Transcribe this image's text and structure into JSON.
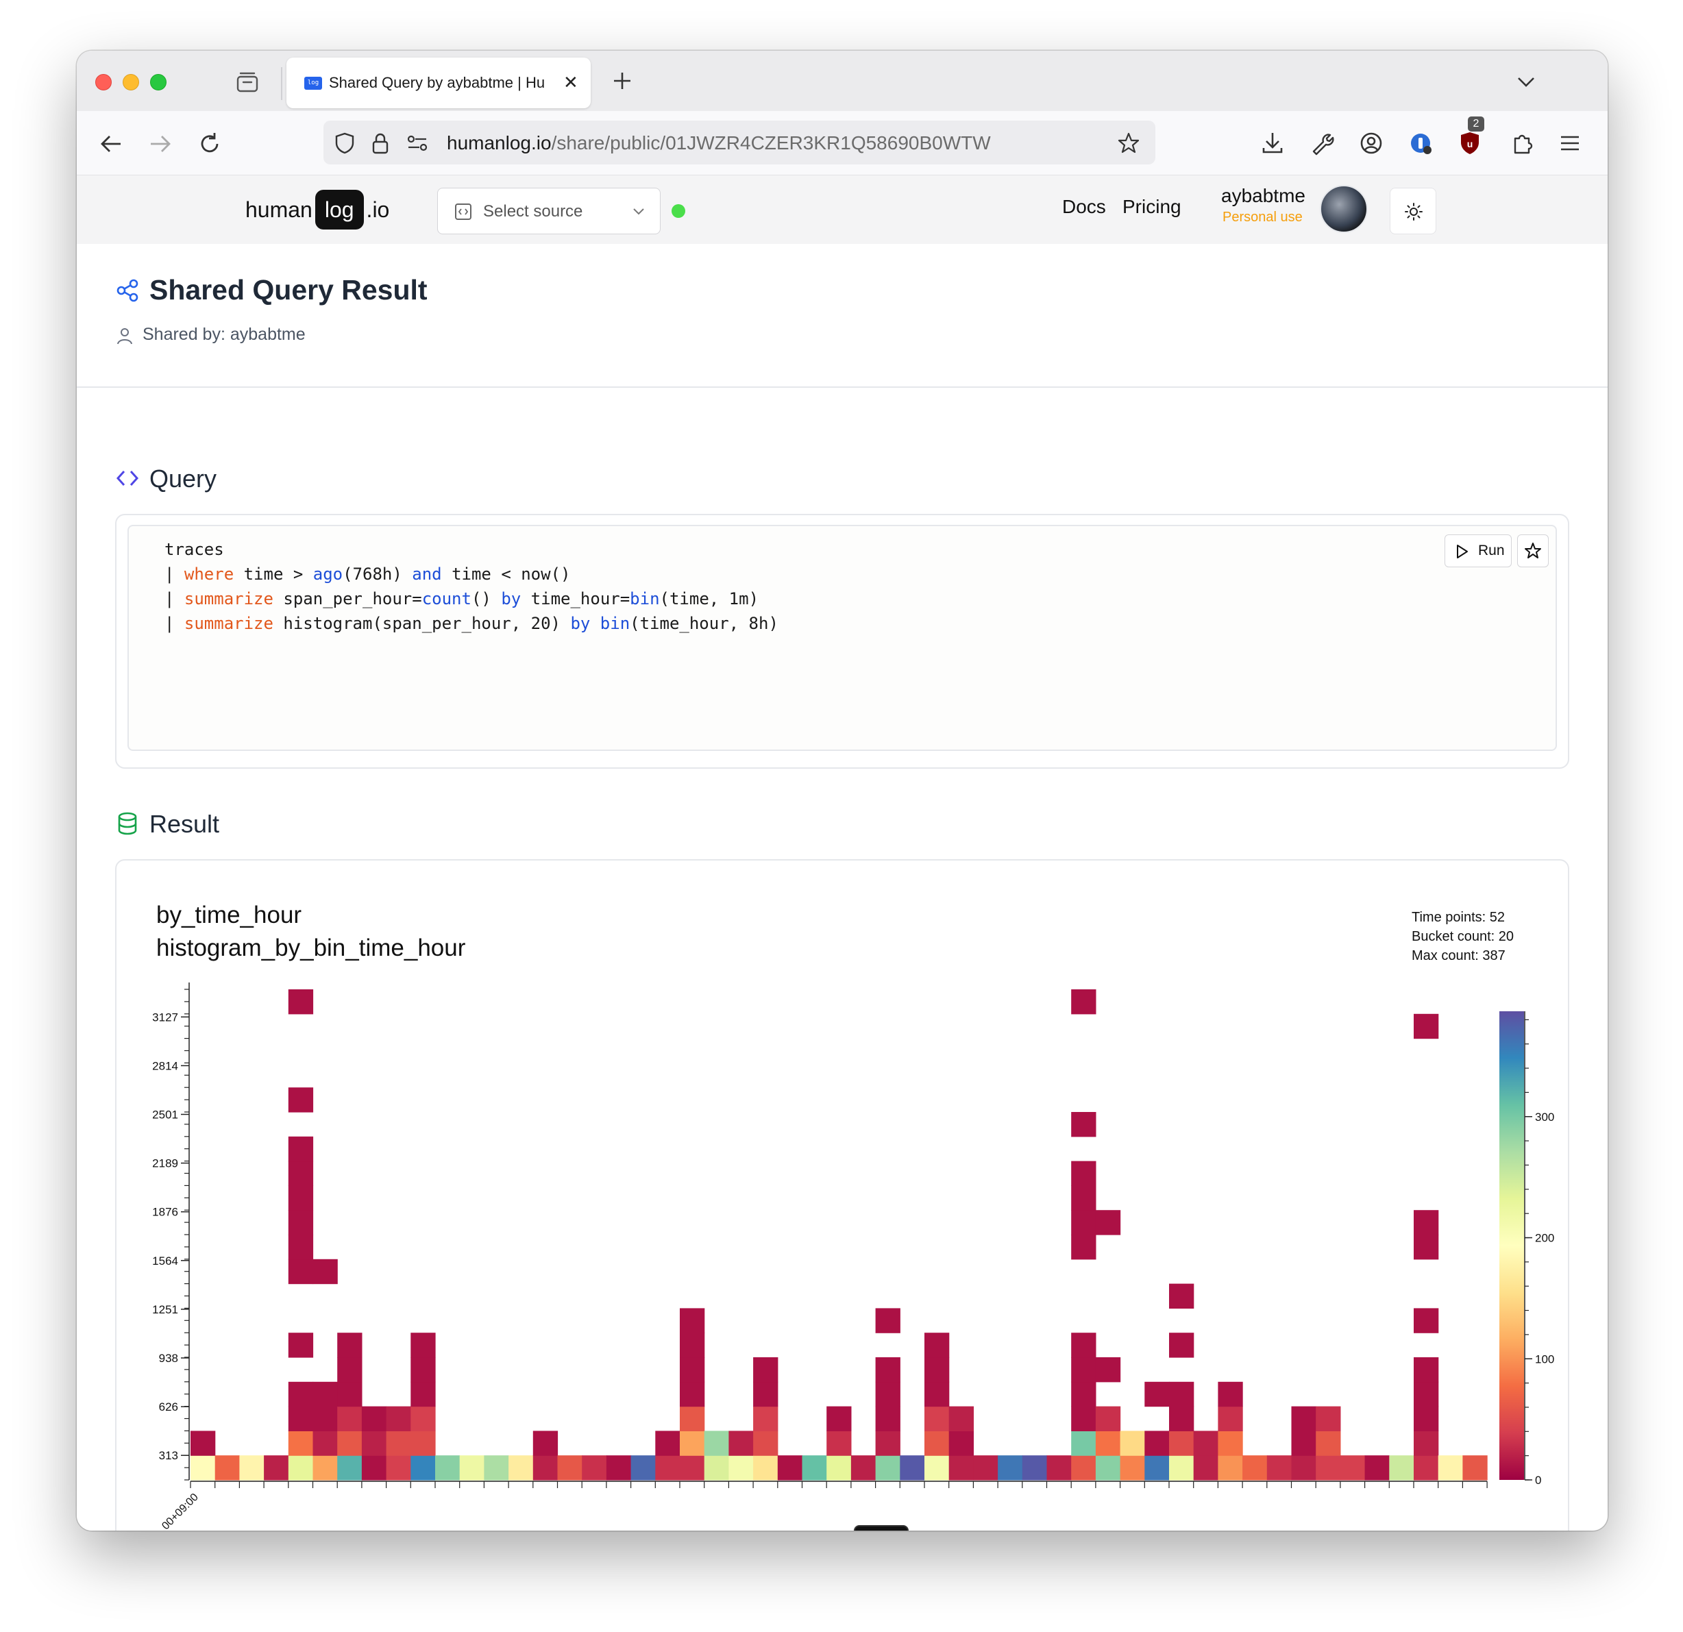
{
  "browser": {
    "tab_title": "Shared Query by aybabtme | Hu",
    "favicon_text": "log",
    "url_host": "humanlog.io",
    "url_path": "/share/public/01JWZR4CZER3KR1Q58690B0WTW",
    "extension_badge": "2"
  },
  "header": {
    "brand_human": "human",
    "brand_log": "log",
    "brand_io": ".io",
    "source_placeholder": "Select source",
    "docs": "Docs",
    "pricing": "Pricing",
    "username": "aybabtme",
    "plan": "Personal use"
  },
  "page": {
    "title": "Shared Query Result",
    "shared_by": "Shared by: aybabtme"
  },
  "query": {
    "section_title": "Query",
    "run_label": "Run"
  },
  "result": {
    "section_title": "Result",
    "title_line1": "by_time_hour",
    "title_line2": "histogram_by_bin_time_hour",
    "time_points": "Time points: 52",
    "bucket_count": "Bucket count: 20",
    "max_count": "Max count: 387"
  },
  "colors": {
    "accent": "#2563eb",
    "status_ok": "#4ade4a",
    "plan": "#f59e0b",
    "keyword": "#e2571b",
    "function": "#1d4ed8"
  },
  "chart_data": {
    "type": "heatmap",
    "title": "by_time_hour",
    "subtitle": "histogram_by_bin_time_hour",
    "x_tick_labels": [
      "…00+09:00"
    ],
    "y_tick_labels": [
      "313",
      "626",
      "938",
      "1251",
      "1564",
      "1876",
      "2189",
      "2501",
      "2814",
      "3127"
    ],
    "colorbar_ticks": [
      0,
      100,
      200,
      300
    ],
    "colorbar_range": [
      0,
      387
    ],
    "colorscale": "Spectral",
    "x_count": 52,
    "bucket_count": 20,
    "cells_note": "each entry: [x_index, bucket_index (0=bottom), count]",
    "cells": [
      [
        0,
        0,
        190
      ],
      [
        0,
        1,
        10
      ],
      [
        1,
        0,
        70
      ],
      [
        2,
        0,
        180
      ],
      [
        3,
        0,
        20
      ],
      [
        4,
        0,
        230
      ],
      [
        4,
        1,
        80
      ],
      [
        4,
        2,
        10
      ],
      [
        4,
        3,
        10
      ],
      [
        4,
        5,
        10
      ],
      [
        4,
        8,
        10
      ],
      [
        4,
        9,
        10
      ],
      [
        4,
        10,
        10
      ],
      [
        4,
        11,
        10
      ],
      [
        4,
        12,
        10
      ],
      [
        4,
        13,
        10
      ],
      [
        4,
        15,
        10
      ],
      [
        4,
        19,
        10
      ],
      [
        5,
        0,
        110
      ],
      [
        5,
        1,
        20
      ],
      [
        5,
        2,
        10
      ],
      [
        5,
        3,
        10
      ],
      [
        5,
        8,
        10
      ],
      [
        6,
        0,
        320
      ],
      [
        6,
        1,
        60
      ],
      [
        6,
        2,
        30
      ],
      [
        6,
        3,
        10
      ],
      [
        6,
        4,
        10
      ],
      [
        6,
        5,
        10
      ],
      [
        7,
        0,
        10
      ],
      [
        7,
        1,
        20
      ],
      [
        7,
        2,
        10
      ],
      [
        8,
        0,
        40
      ],
      [
        8,
        1,
        50
      ],
      [
        8,
        2,
        20
      ],
      [
        9,
        0,
        350
      ],
      [
        9,
        1,
        50
      ],
      [
        9,
        2,
        40
      ],
      [
        9,
        3,
        10
      ],
      [
        9,
        4,
        10
      ],
      [
        9,
        5,
        10
      ],
      [
        10,
        0,
        290
      ],
      [
        11,
        0,
        220
      ],
      [
        12,
        0,
        270
      ],
      [
        13,
        0,
        170
      ],
      [
        14,
        0,
        20
      ],
      [
        14,
        1,
        10
      ],
      [
        15,
        0,
        60
      ],
      [
        16,
        0,
        30
      ],
      [
        17,
        0,
        10
      ],
      [
        18,
        0,
        370
      ],
      [
        19,
        0,
        30
      ],
      [
        19,
        1,
        10
      ],
      [
        20,
        0,
        30
      ],
      [
        20,
        1,
        110
      ],
      [
        20,
        2,
        60
      ],
      [
        20,
        3,
        10
      ],
      [
        20,
        4,
        10
      ],
      [
        20,
        5,
        10
      ],
      [
        20,
        6,
        10
      ],
      [
        21,
        0,
        240
      ],
      [
        21,
        1,
        280
      ],
      [
        22,
        0,
        210
      ],
      [
        22,
        1,
        20
      ],
      [
        23,
        0,
        160
      ],
      [
        23,
        1,
        50
      ],
      [
        23,
        2,
        40
      ],
      [
        23,
        3,
        10
      ],
      [
        23,
        4,
        10
      ],
      [
        24,
        0,
        10
      ],
      [
        25,
        0,
        310
      ],
      [
        26,
        0,
        230
      ],
      [
        26,
        1,
        30
      ],
      [
        26,
        2,
        10
      ],
      [
        27,
        0,
        20
      ],
      [
        28,
        0,
        290
      ],
      [
        28,
        1,
        20
      ],
      [
        28,
        2,
        10
      ],
      [
        28,
        3,
        10
      ],
      [
        28,
        4,
        10
      ],
      [
        28,
        6,
        10
      ],
      [
        29,
        0,
        380
      ],
      [
        30,
        0,
        210
      ],
      [
        30,
        1,
        60
      ],
      [
        30,
        2,
        40
      ],
      [
        30,
        3,
        10
      ],
      [
        30,
        4,
        10
      ],
      [
        30,
        5,
        10
      ],
      [
        31,
        0,
        20
      ],
      [
        31,
        1,
        10
      ],
      [
        31,
        2,
        20
      ],
      [
        32,
        0,
        20
      ],
      [
        33,
        0,
        360
      ],
      [
        34,
        0,
        380
      ],
      [
        35,
        0,
        20
      ],
      [
        36,
        0,
        60
      ],
      [
        36,
        1,
        300
      ],
      [
        36,
        2,
        10
      ],
      [
        36,
        3,
        10
      ],
      [
        36,
        4,
        10
      ],
      [
        36,
        5,
        10
      ],
      [
        36,
        9,
        10
      ],
      [
        36,
        10,
        10
      ],
      [
        36,
        11,
        10
      ],
      [
        36,
        12,
        10
      ],
      [
        36,
        14,
        10
      ],
      [
        36,
        19,
        10
      ],
      [
        37,
        0,
        290
      ],
      [
        37,
        1,
        80
      ],
      [
        37,
        2,
        30
      ],
      [
        37,
        4,
        10
      ],
      [
        37,
        10,
        10
      ],
      [
        38,
        0,
        90
      ],
      [
        38,
        1,
        150
      ],
      [
        39,
        0,
        360
      ],
      [
        39,
        1,
        10
      ],
      [
        39,
        3,
        10
      ],
      [
        40,
        0,
        220
      ],
      [
        40,
        1,
        50
      ],
      [
        40,
        2,
        10
      ],
      [
        40,
        3,
        10
      ],
      [
        40,
        5,
        10
      ],
      [
        40,
        7,
        10
      ],
      [
        41,
        0,
        20
      ],
      [
        41,
        1,
        20
      ],
      [
        42,
        0,
        100
      ],
      [
        42,
        1,
        80
      ],
      [
        42,
        2,
        30
      ],
      [
        42,
        3,
        10
      ],
      [
        43,
        0,
        70
      ],
      [
        44,
        0,
        30
      ],
      [
        45,
        0,
        20
      ],
      [
        45,
        1,
        10
      ],
      [
        45,
        2,
        10
      ],
      [
        46,
        0,
        40
      ],
      [
        46,
        1,
        60
      ],
      [
        46,
        2,
        30
      ],
      [
        47,
        0,
        40
      ],
      [
        48,
        0,
        10
      ],
      [
        49,
        0,
        250
      ],
      [
        50,
        0,
        30
      ],
      [
        50,
        1,
        20
      ],
      [
        50,
        2,
        10
      ],
      [
        50,
        3,
        10
      ],
      [
        50,
        4,
        10
      ],
      [
        50,
        6,
        10
      ],
      [
        50,
        9,
        10
      ],
      [
        50,
        10,
        10
      ],
      [
        50,
        18,
        10
      ],
      [
        51,
        0,
        180
      ],
      [
        52,
        0,
        60
      ]
    ]
  }
}
